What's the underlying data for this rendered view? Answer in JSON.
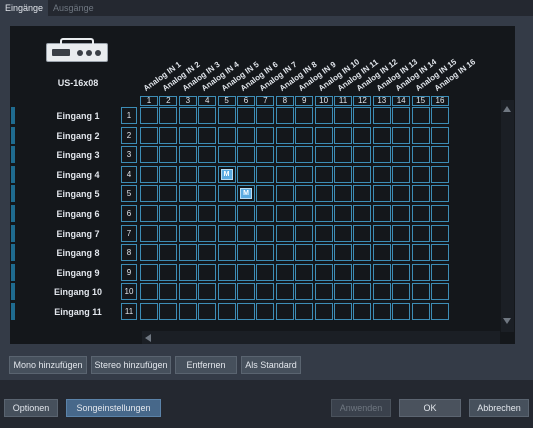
{
  "tabs": [
    {
      "label": "Eingänge",
      "active": true
    },
    {
      "label": "Ausgänge",
      "active": false
    }
  ],
  "device": {
    "name": "US-16x08",
    "icon": "audio-interface-icon"
  },
  "columns": [
    {
      "label": "Analog IN 1",
      "num": "1"
    },
    {
      "label": "Analog IN 2",
      "num": "2"
    },
    {
      "label": "Analog IN 3",
      "num": "3"
    },
    {
      "label": "Analog IN 4",
      "num": "4"
    },
    {
      "label": "Analog IN 5",
      "num": "5"
    },
    {
      "label": "Analog IN 6",
      "num": "6"
    },
    {
      "label": "Analog IN 7",
      "num": "7"
    },
    {
      "label": "Analog IN 8",
      "num": "8"
    },
    {
      "label": "Analog IN 9",
      "num": "9"
    },
    {
      "label": "Analog IN 10",
      "num": "10"
    },
    {
      "label": "Analog IN 11",
      "num": "11"
    },
    {
      "label": "Analog IN 12",
      "num": "12"
    },
    {
      "label": "Analog IN 13",
      "num": "13"
    },
    {
      "label": "Analog IN 14",
      "num": "14"
    },
    {
      "label": "Analog IN 15",
      "num": "15"
    },
    {
      "label": "Analog IN 16",
      "num": "16"
    }
  ],
  "rows": [
    {
      "label": "Eingang 1",
      "num": "1"
    },
    {
      "label": "Eingang 2",
      "num": "2"
    },
    {
      "label": "Eingang 3",
      "num": "3"
    },
    {
      "label": "Eingang 4",
      "num": "4"
    },
    {
      "label": "Eingang 5",
      "num": "5"
    },
    {
      "label": "Eingang 6",
      "num": "6"
    },
    {
      "label": "Eingang 7",
      "num": "7"
    },
    {
      "label": "Eingang 8",
      "num": "8"
    },
    {
      "label": "Eingang 9",
      "num": "9"
    },
    {
      "label": "Eingang 10",
      "num": "10"
    },
    {
      "label": "Eingang 11",
      "num": "11"
    }
  ],
  "assignments": [
    {
      "row": 4,
      "col": 5,
      "mark": "M"
    },
    {
      "row": 5,
      "col": 6,
      "mark": "M"
    }
  ],
  "matrix_buttons": {
    "mono": "Mono hinzufügen",
    "stereo": "Stereo hinzufügen",
    "remove": "Entfernen",
    "default": "Als Standard"
  },
  "footer": {
    "options": "Optionen",
    "song_settings": "Songeinstellungen",
    "apply": "Anwenden",
    "ok": "OK",
    "cancel": "Abbrechen"
  },
  "colors": {
    "grid": "#3d8db6",
    "accent": "#5aaae0",
    "background": "#242830"
  }
}
